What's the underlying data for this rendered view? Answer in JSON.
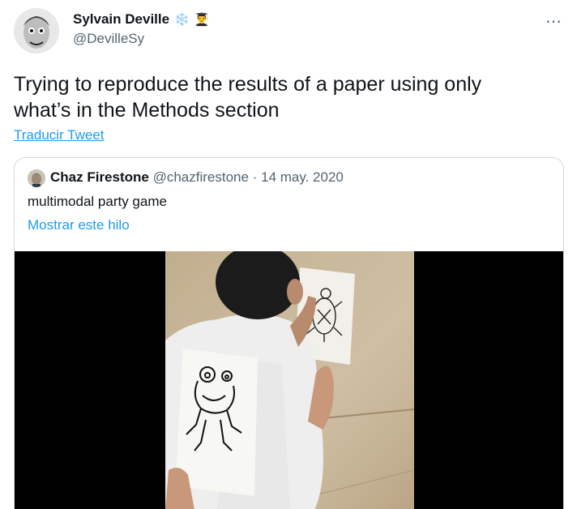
{
  "author": {
    "name": "Sylvain Deville",
    "badges": [
      "❄️",
      "👨‍🎓"
    ],
    "handle": "@DevilleSy",
    "avatar_icon": "avatar-photo-icon"
  },
  "more_icon": "⋯",
  "tweet": {
    "line1": "Trying to reproduce the results of a paper using only",
    "line2": "what’s in the Methods section"
  },
  "translate_label": "Traducir Tweet",
  "quoted": {
    "name": "Chaz Firestone",
    "handle": "@chazfirestone",
    "dot": "·",
    "date": "14 may. 2020",
    "text": "multimodal party game",
    "thread_link": "Mostrar este hilo"
  },
  "colors": {
    "link": "#1d9bf0",
    "secondary_text": "#536471",
    "border": "#cfd9de"
  }
}
